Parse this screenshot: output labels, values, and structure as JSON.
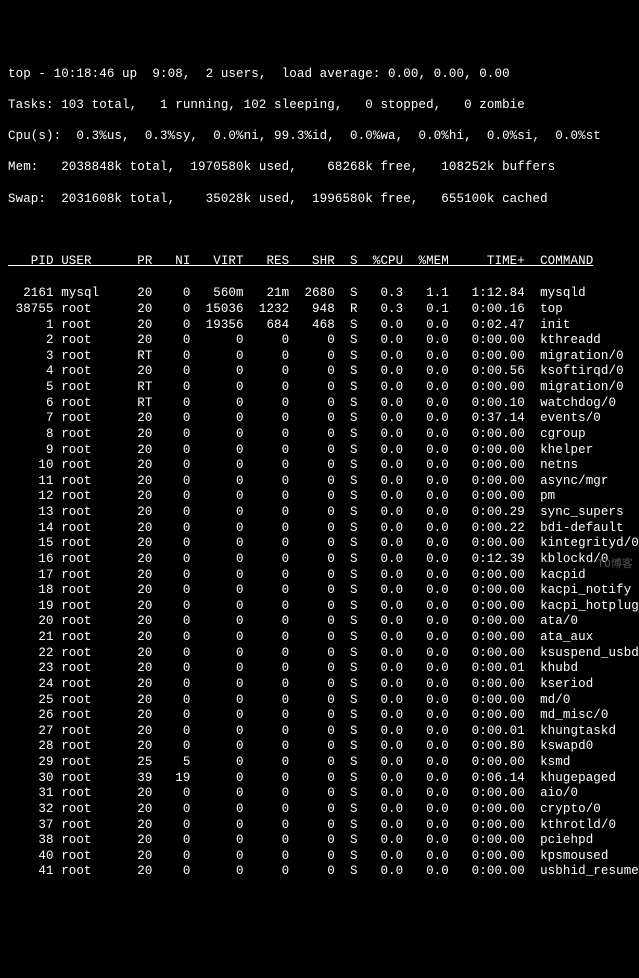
{
  "header": {
    "line1": "top - 10:18:46 up  9:08,  2 users,  load average: 0.00, 0.00, 0.00",
    "line2": "Tasks: 103 total,   1 running, 102 sleeping,   0 stopped,   0 zombie",
    "line3": "Cpu(s):  0.3%us,  0.3%sy,  0.0%ni, 99.3%id,  0.0%wa,  0.0%hi,  0.0%si,  0.0%st",
    "line4": "Mem:   2038848k total,  1970580k used,    68268k free,   108252k buffers",
    "line5": "Swap:  2031608k total,    35028k used,  1996580k free,   655100k cached"
  },
  "columns": [
    "PID",
    "USER",
    "PR",
    "NI",
    "VIRT",
    "RES",
    "SHR",
    "S",
    "%CPU",
    "%MEM",
    "TIME+",
    "COMMAND"
  ],
  "rows": [
    {
      "pid": "2161",
      "user": "mysql",
      "pr": "20",
      "ni": "0",
      "virt": "560m",
      "res": "21m",
      "shr": "2680",
      "s": "S",
      "cpu": "0.3",
      "mem": "1.1",
      "time": "1:12.84",
      "cmd": "mysqld"
    },
    {
      "pid": "38755",
      "user": "root",
      "pr": "20",
      "ni": "0",
      "virt": "15036",
      "res": "1232",
      "shr": "948",
      "s": "R",
      "cpu": "0.3",
      "mem": "0.1",
      "time": "0:00.16",
      "cmd": "top"
    },
    {
      "pid": "1",
      "user": "root",
      "pr": "20",
      "ni": "0",
      "virt": "19356",
      "res": "684",
      "shr": "468",
      "s": "S",
      "cpu": "0.0",
      "mem": "0.0",
      "time": "0:02.47",
      "cmd": "init"
    },
    {
      "pid": "2",
      "user": "root",
      "pr": "20",
      "ni": "0",
      "virt": "0",
      "res": "0",
      "shr": "0",
      "s": "S",
      "cpu": "0.0",
      "mem": "0.0",
      "time": "0:00.00",
      "cmd": "kthreadd"
    },
    {
      "pid": "3",
      "user": "root",
      "pr": "RT",
      "ni": "0",
      "virt": "0",
      "res": "0",
      "shr": "0",
      "s": "S",
      "cpu": "0.0",
      "mem": "0.0",
      "time": "0:00.00",
      "cmd": "migration/0"
    },
    {
      "pid": "4",
      "user": "root",
      "pr": "20",
      "ni": "0",
      "virt": "0",
      "res": "0",
      "shr": "0",
      "s": "S",
      "cpu": "0.0",
      "mem": "0.0",
      "time": "0:00.56",
      "cmd": "ksoftirqd/0"
    },
    {
      "pid": "5",
      "user": "root",
      "pr": "RT",
      "ni": "0",
      "virt": "0",
      "res": "0",
      "shr": "0",
      "s": "S",
      "cpu": "0.0",
      "mem": "0.0",
      "time": "0:00.00",
      "cmd": "migration/0"
    },
    {
      "pid": "6",
      "user": "root",
      "pr": "RT",
      "ni": "0",
      "virt": "0",
      "res": "0",
      "shr": "0",
      "s": "S",
      "cpu": "0.0",
      "mem": "0.0",
      "time": "0:00.10",
      "cmd": "watchdog/0"
    },
    {
      "pid": "7",
      "user": "root",
      "pr": "20",
      "ni": "0",
      "virt": "0",
      "res": "0",
      "shr": "0",
      "s": "S",
      "cpu": "0.0",
      "mem": "0.0",
      "time": "0:37.14",
      "cmd": "events/0"
    },
    {
      "pid": "8",
      "user": "root",
      "pr": "20",
      "ni": "0",
      "virt": "0",
      "res": "0",
      "shr": "0",
      "s": "S",
      "cpu": "0.0",
      "mem": "0.0",
      "time": "0:00.00",
      "cmd": "cgroup"
    },
    {
      "pid": "9",
      "user": "root",
      "pr": "20",
      "ni": "0",
      "virt": "0",
      "res": "0",
      "shr": "0",
      "s": "S",
      "cpu": "0.0",
      "mem": "0.0",
      "time": "0:00.00",
      "cmd": "khelper"
    },
    {
      "pid": "10",
      "user": "root",
      "pr": "20",
      "ni": "0",
      "virt": "0",
      "res": "0",
      "shr": "0",
      "s": "S",
      "cpu": "0.0",
      "mem": "0.0",
      "time": "0:00.00",
      "cmd": "netns"
    },
    {
      "pid": "11",
      "user": "root",
      "pr": "20",
      "ni": "0",
      "virt": "0",
      "res": "0",
      "shr": "0",
      "s": "S",
      "cpu": "0.0",
      "mem": "0.0",
      "time": "0:00.00",
      "cmd": "async/mgr"
    },
    {
      "pid": "12",
      "user": "root",
      "pr": "20",
      "ni": "0",
      "virt": "0",
      "res": "0",
      "shr": "0",
      "s": "S",
      "cpu": "0.0",
      "mem": "0.0",
      "time": "0:00.00",
      "cmd": "pm"
    },
    {
      "pid": "13",
      "user": "root",
      "pr": "20",
      "ni": "0",
      "virt": "0",
      "res": "0",
      "shr": "0",
      "s": "S",
      "cpu": "0.0",
      "mem": "0.0",
      "time": "0:00.29",
      "cmd": "sync_supers"
    },
    {
      "pid": "14",
      "user": "root",
      "pr": "20",
      "ni": "0",
      "virt": "0",
      "res": "0",
      "shr": "0",
      "s": "S",
      "cpu": "0.0",
      "mem": "0.0",
      "time": "0:00.22",
      "cmd": "bdi-default"
    },
    {
      "pid": "15",
      "user": "root",
      "pr": "20",
      "ni": "0",
      "virt": "0",
      "res": "0",
      "shr": "0",
      "s": "S",
      "cpu": "0.0",
      "mem": "0.0",
      "time": "0:00.00",
      "cmd": "kintegrityd/0"
    },
    {
      "pid": "16",
      "user": "root",
      "pr": "20",
      "ni": "0",
      "virt": "0",
      "res": "0",
      "shr": "0",
      "s": "S",
      "cpu": "0.0",
      "mem": "0.0",
      "time": "0:12.39",
      "cmd": "kblockd/0"
    },
    {
      "pid": "17",
      "user": "root",
      "pr": "20",
      "ni": "0",
      "virt": "0",
      "res": "0",
      "shr": "0",
      "s": "S",
      "cpu": "0.0",
      "mem": "0.0",
      "time": "0:00.00",
      "cmd": "kacpid"
    },
    {
      "pid": "18",
      "user": "root",
      "pr": "20",
      "ni": "0",
      "virt": "0",
      "res": "0",
      "shr": "0",
      "s": "S",
      "cpu": "0.0",
      "mem": "0.0",
      "time": "0:00.00",
      "cmd": "kacpi_notify"
    },
    {
      "pid": "19",
      "user": "root",
      "pr": "20",
      "ni": "0",
      "virt": "0",
      "res": "0",
      "shr": "0",
      "s": "S",
      "cpu": "0.0",
      "mem": "0.0",
      "time": "0:00.00",
      "cmd": "kacpi_hotplug"
    },
    {
      "pid": "20",
      "user": "root",
      "pr": "20",
      "ni": "0",
      "virt": "0",
      "res": "0",
      "shr": "0",
      "s": "S",
      "cpu": "0.0",
      "mem": "0.0",
      "time": "0:00.00",
      "cmd": "ata/0"
    },
    {
      "pid": "21",
      "user": "root",
      "pr": "20",
      "ni": "0",
      "virt": "0",
      "res": "0",
      "shr": "0",
      "s": "S",
      "cpu": "0.0",
      "mem": "0.0",
      "time": "0:00.00",
      "cmd": "ata_aux"
    },
    {
      "pid": "22",
      "user": "root",
      "pr": "20",
      "ni": "0",
      "virt": "0",
      "res": "0",
      "shr": "0",
      "s": "S",
      "cpu": "0.0",
      "mem": "0.0",
      "time": "0:00.00",
      "cmd": "ksuspend_usbd"
    },
    {
      "pid": "23",
      "user": "root",
      "pr": "20",
      "ni": "0",
      "virt": "0",
      "res": "0",
      "shr": "0",
      "s": "S",
      "cpu": "0.0",
      "mem": "0.0",
      "time": "0:00.01",
      "cmd": "khubd"
    },
    {
      "pid": "24",
      "user": "root",
      "pr": "20",
      "ni": "0",
      "virt": "0",
      "res": "0",
      "shr": "0",
      "s": "S",
      "cpu": "0.0",
      "mem": "0.0",
      "time": "0:00.00",
      "cmd": "kseriod"
    },
    {
      "pid": "25",
      "user": "root",
      "pr": "20",
      "ni": "0",
      "virt": "0",
      "res": "0",
      "shr": "0",
      "s": "S",
      "cpu": "0.0",
      "mem": "0.0",
      "time": "0:00.00",
      "cmd": "md/0"
    },
    {
      "pid": "26",
      "user": "root",
      "pr": "20",
      "ni": "0",
      "virt": "0",
      "res": "0",
      "shr": "0",
      "s": "S",
      "cpu": "0.0",
      "mem": "0.0",
      "time": "0:00.00",
      "cmd": "md_misc/0"
    },
    {
      "pid": "27",
      "user": "root",
      "pr": "20",
      "ni": "0",
      "virt": "0",
      "res": "0",
      "shr": "0",
      "s": "S",
      "cpu": "0.0",
      "mem": "0.0",
      "time": "0:00.01",
      "cmd": "khungtaskd"
    },
    {
      "pid": "28",
      "user": "root",
      "pr": "20",
      "ni": "0",
      "virt": "0",
      "res": "0",
      "shr": "0",
      "s": "S",
      "cpu": "0.0",
      "mem": "0.0",
      "time": "0:00.80",
      "cmd": "kswapd0"
    },
    {
      "pid": "29",
      "user": "root",
      "pr": "25",
      "ni": "5",
      "virt": "0",
      "res": "0",
      "shr": "0",
      "s": "S",
      "cpu": "0.0",
      "mem": "0.0",
      "time": "0:00.00",
      "cmd": "ksmd"
    },
    {
      "pid": "30",
      "user": "root",
      "pr": "39",
      "ni": "19",
      "virt": "0",
      "res": "0",
      "shr": "0",
      "s": "S",
      "cpu": "0.0",
      "mem": "0.0",
      "time": "0:06.14",
      "cmd": "khugepaged"
    },
    {
      "pid": "31",
      "user": "root",
      "pr": "20",
      "ni": "0",
      "virt": "0",
      "res": "0",
      "shr": "0",
      "s": "S",
      "cpu": "0.0",
      "mem": "0.0",
      "time": "0:00.00",
      "cmd": "aio/0"
    },
    {
      "pid": "32",
      "user": "root",
      "pr": "20",
      "ni": "0",
      "virt": "0",
      "res": "0",
      "shr": "0",
      "s": "S",
      "cpu": "0.0",
      "mem": "0.0",
      "time": "0:00.00",
      "cmd": "crypto/0"
    },
    {
      "pid": "37",
      "user": "root",
      "pr": "20",
      "ni": "0",
      "virt": "0",
      "res": "0",
      "shr": "0",
      "s": "S",
      "cpu": "0.0",
      "mem": "0.0",
      "time": "0:00.00",
      "cmd": "kthrotld/0"
    },
    {
      "pid": "38",
      "user": "root",
      "pr": "20",
      "ni": "0",
      "virt": "0",
      "res": "0",
      "shr": "0",
      "s": "S",
      "cpu": "0.0",
      "mem": "0.0",
      "time": "0:00.00",
      "cmd": "pciehpd"
    },
    {
      "pid": "40",
      "user": "root",
      "pr": "20",
      "ni": "0",
      "virt": "0",
      "res": "0",
      "shr": "0",
      "s": "S",
      "cpu": "0.0",
      "mem": "0.0",
      "time": "0:00.00",
      "cmd": "kpsmoused"
    },
    {
      "pid": "41",
      "user": "root",
      "pr": "20",
      "ni": "0",
      "virt": "0",
      "res": "0",
      "shr": "0",
      "s": "S",
      "cpu": "0.0",
      "mem": "0.0",
      "time": "0:00.00",
      "cmd": "usbhid_resumer"
    }
  ],
  "watermark": "TO博客"
}
